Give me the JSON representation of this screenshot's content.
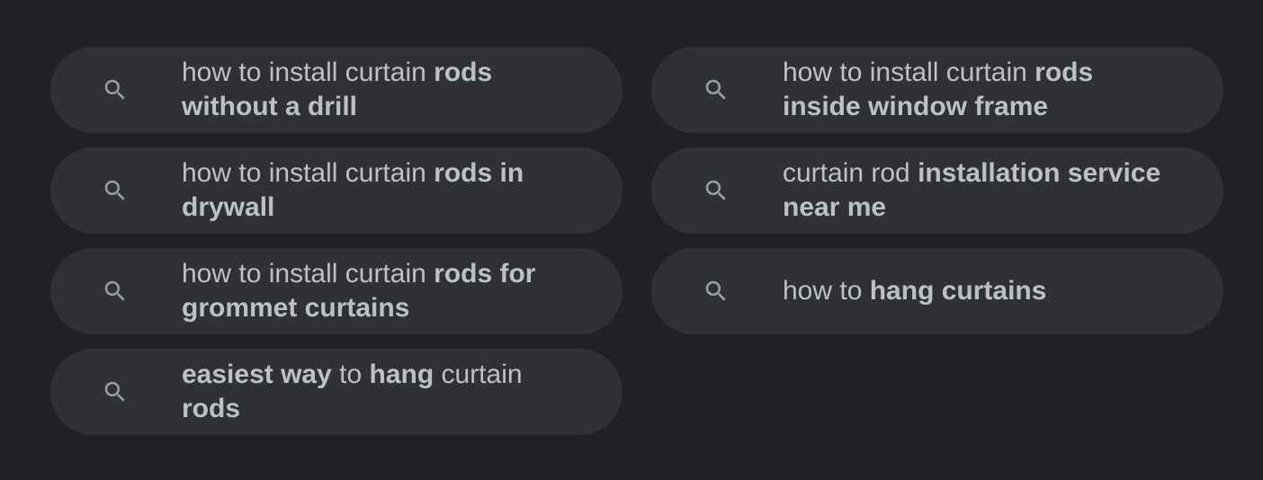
{
  "colors": {
    "background": "#202124",
    "chip_background": "#303134",
    "text": "#bdc1c6",
    "icon": "#9aa0a6"
  },
  "related_searches": [
    {
      "icon": "search-icon",
      "segments": [
        {
          "text": "how to install curtain ",
          "bold": false
        },
        {
          "text": "rods without a drill",
          "bold": true
        }
      ]
    },
    {
      "icon": "search-icon",
      "segments": [
        {
          "text": "how to install curtain ",
          "bold": false
        },
        {
          "text": "rods inside window frame",
          "bold": true
        }
      ]
    },
    {
      "icon": "search-icon",
      "segments": [
        {
          "text": "how to install curtain ",
          "bold": false
        },
        {
          "text": "rods in drywall",
          "bold": true
        }
      ]
    },
    {
      "icon": "search-icon",
      "segments": [
        {
          "text": "curtain rod ",
          "bold": false
        },
        {
          "text": "installation service near me",
          "bold": true
        }
      ]
    },
    {
      "icon": "search-icon",
      "segments": [
        {
          "text": "how to install curtain ",
          "bold": false
        },
        {
          "text": "rods for grommet curtains",
          "bold": true
        }
      ]
    },
    {
      "icon": "search-icon",
      "segments": [
        {
          "text": "how to ",
          "bold": false
        },
        {
          "text": "hang curtains",
          "bold": true
        }
      ]
    },
    {
      "icon": "search-icon",
      "segments": [
        {
          "text": "easiest way",
          "bold": true
        },
        {
          "text": " to ",
          "bold": false
        },
        {
          "text": "hang",
          "bold": true
        },
        {
          "text": " curtain ",
          "bold": false
        },
        {
          "text": "rods",
          "bold": true
        }
      ]
    }
  ]
}
